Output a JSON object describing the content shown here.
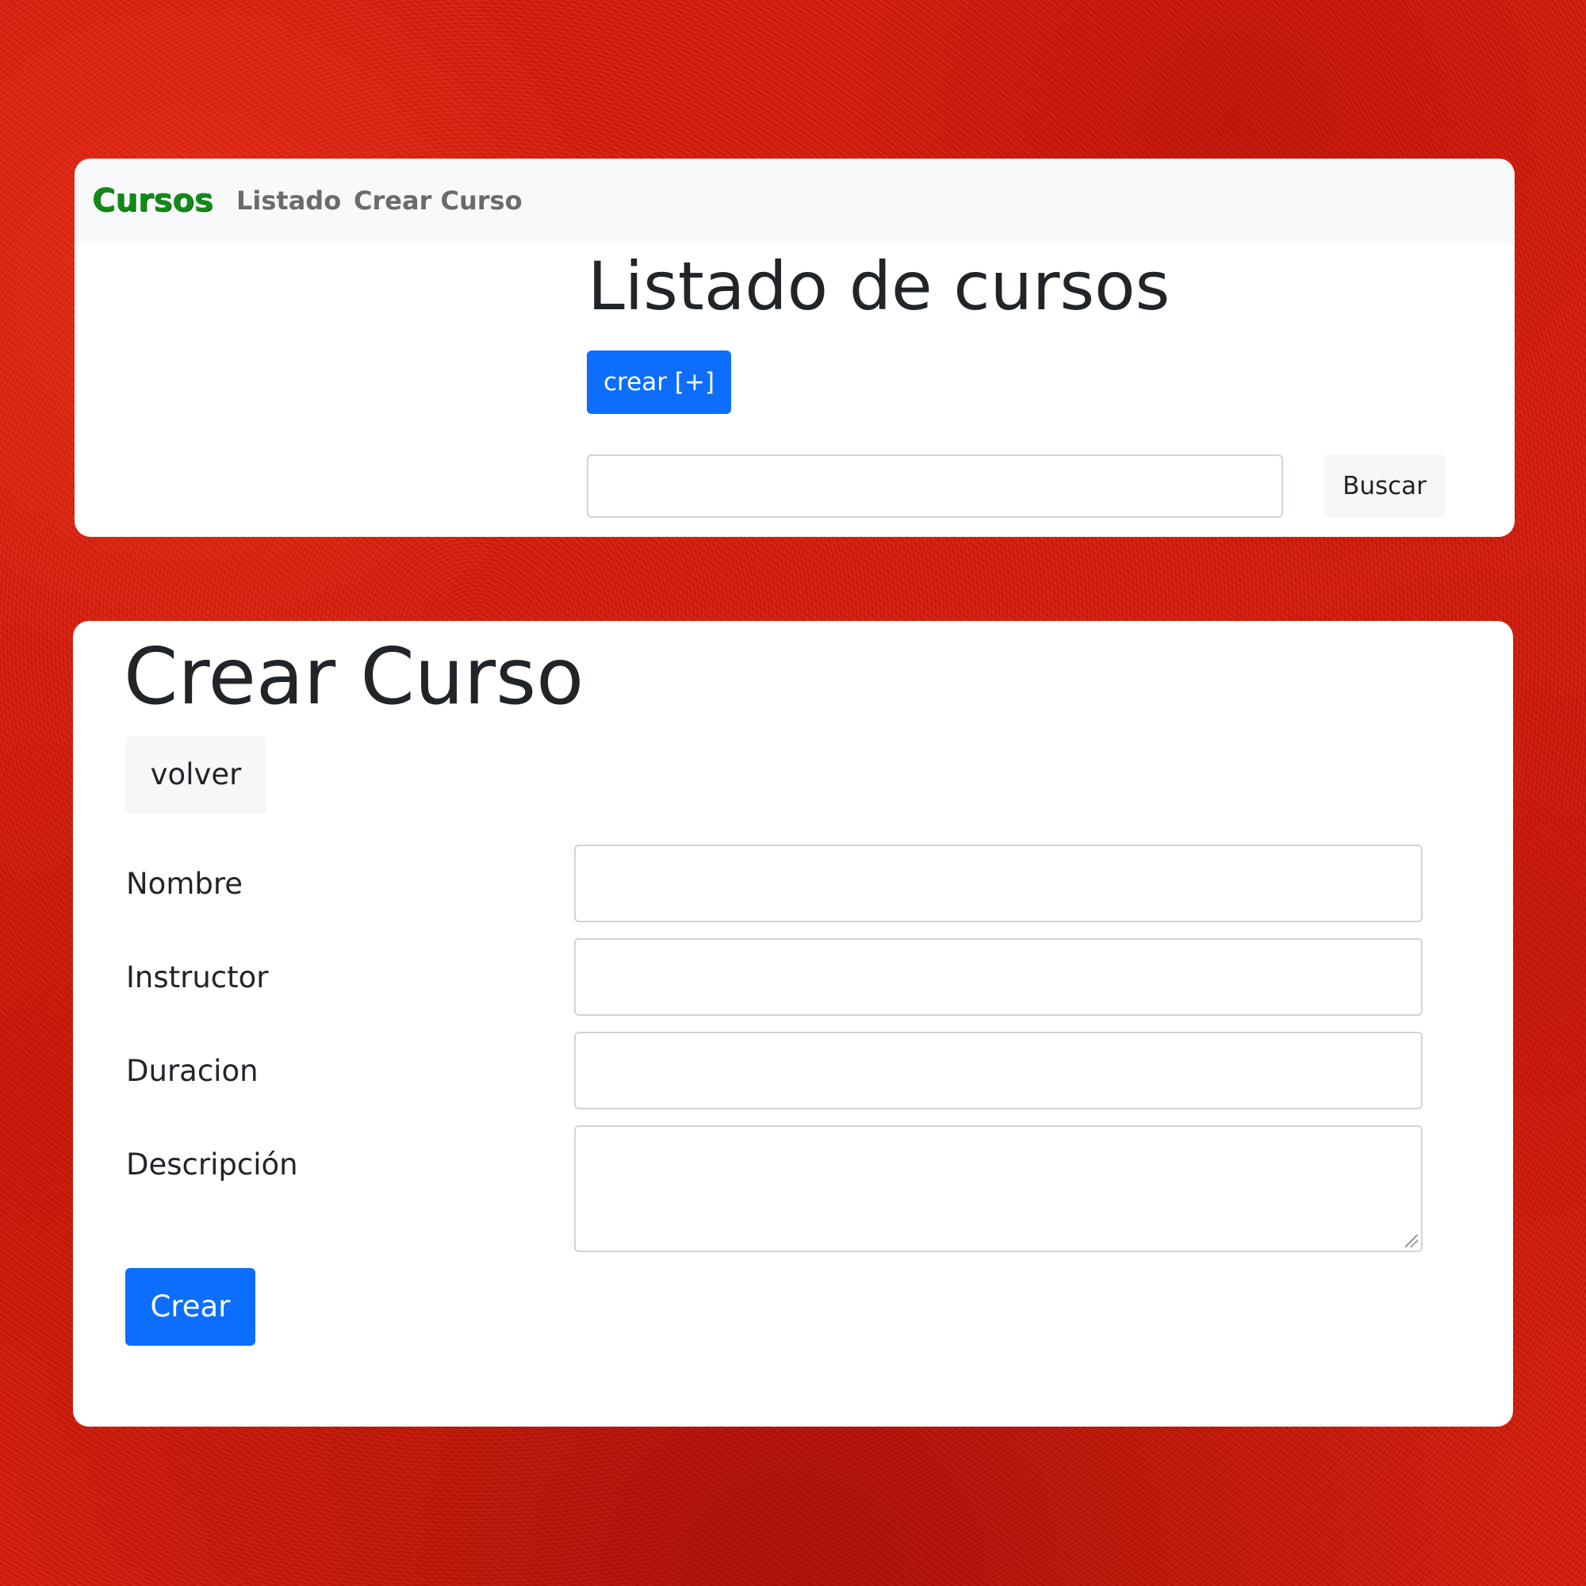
{
  "colors": {
    "primary": "#0d6efd",
    "brand": "#128a17",
    "background": "#d81a08",
    "navbar": "#f8f9fa"
  },
  "navbar": {
    "brand": "Cursos",
    "links": [
      {
        "label": "Listado"
      },
      {
        "label": "Crear Curso"
      }
    ]
  },
  "listing": {
    "title": "Listado de cursos",
    "create_button": "crear [+]",
    "search": {
      "value": "",
      "placeholder": "",
      "button_label": "Buscar"
    }
  },
  "create_form": {
    "title": "Crear Curso",
    "back_button": "volver",
    "fields": [
      {
        "label": "Nombre",
        "value": ""
      },
      {
        "label": "Instructor",
        "value": ""
      },
      {
        "label": "Duracion",
        "value": ""
      },
      {
        "label": "Descripción",
        "value": ""
      }
    ],
    "submit_button": "Crear"
  }
}
